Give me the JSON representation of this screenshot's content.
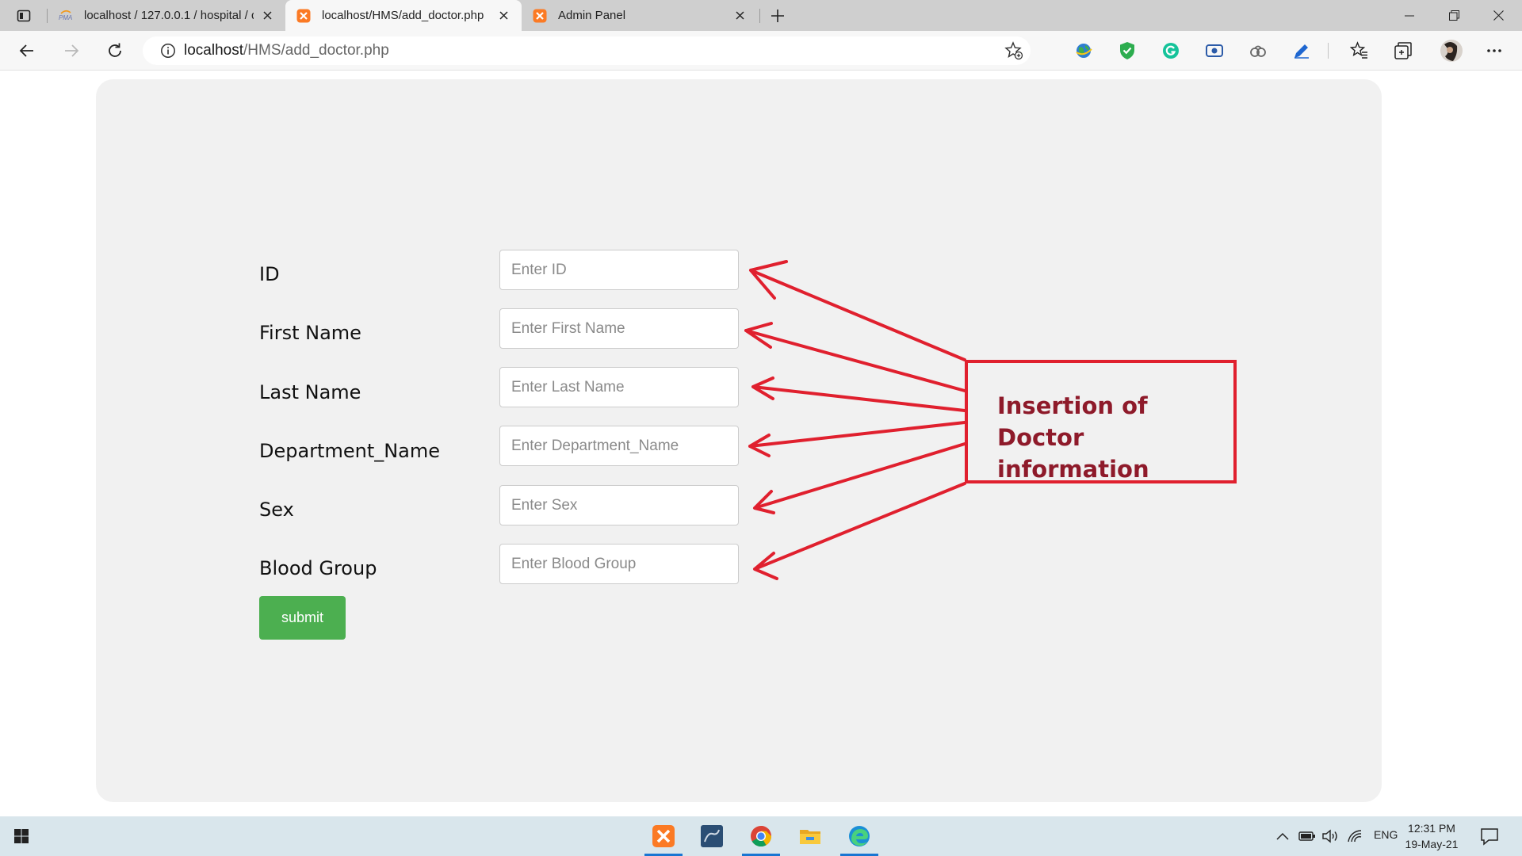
{
  "browser": {
    "tabs": [
      {
        "label": "localhost / 127.0.0.1 / hospital / d",
        "icon": "phpmyadmin-icon",
        "active": false
      },
      {
        "label": "localhost/HMS/add_doctor.php",
        "icon": "xampp-icon",
        "active": true
      },
      {
        "label": "Admin Panel",
        "icon": "xampp-icon",
        "active": false
      }
    ],
    "address": {
      "host": "localhost",
      "path": "/HMS/add_doctor.php"
    }
  },
  "form": {
    "fields": [
      {
        "label": "ID",
        "placeholder": "Enter ID"
      },
      {
        "label": "First Name",
        "placeholder": "Enter First Name"
      },
      {
        "label": "Last Name",
        "placeholder": "Enter Last Name"
      },
      {
        "label": "Department_Name",
        "placeholder": "Enter Department_Name"
      },
      {
        "label": "Sex",
        "placeholder": "Enter Sex"
      },
      {
        "label": "Blood Group",
        "placeholder": "Enter Blood Group"
      }
    ],
    "submit_label": "submit"
  },
  "annotation": {
    "line1": "Insertion of Doctor",
    "line2": "information",
    "color": "#e0202e"
  },
  "taskbar": {
    "apps": [
      "xampp-icon",
      "mysql-workbench-icon",
      "chrome-icon",
      "file-explorer-icon",
      "edge-icon"
    ],
    "language": "ENG",
    "time": "12:31 PM",
    "date": "19-May-21"
  },
  "colors": {
    "submit": "#4caf50",
    "card": "#f1f1f1",
    "accent": "#1976d2"
  }
}
